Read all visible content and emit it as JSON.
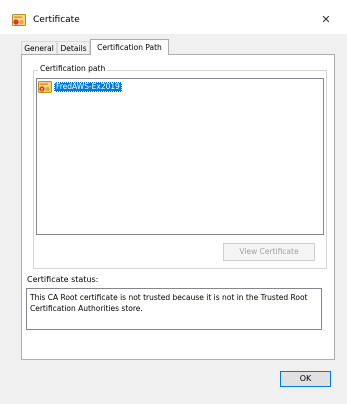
{
  "window": {
    "title": "Certificate",
    "close_glyph": "✕"
  },
  "tabs": [
    {
      "label": "General",
      "active": false
    },
    {
      "label": "Details",
      "active": false
    },
    {
      "label": "Certification Path",
      "active": true
    }
  ],
  "certification_path": {
    "group_label": "Certification path",
    "items": [
      {
        "label": "FredAWS-Ex2019",
        "icon": "certificate-warning-icon",
        "selected": true
      }
    ],
    "view_button_label": "View Certificate",
    "view_button_enabled": false
  },
  "status": {
    "label": "Certificate status:",
    "text": "This CA Root certificate is not trusted because it is not in the Trusted Root Certification Authorities store."
  },
  "footer": {
    "ok_label": "OK"
  },
  "colors": {
    "selection": "#0078d7",
    "dialog_background": "#f0f0f0",
    "panel_background": "#ffffff",
    "icon_orange": "#e8a33d",
    "icon_red": "#d9372a"
  }
}
